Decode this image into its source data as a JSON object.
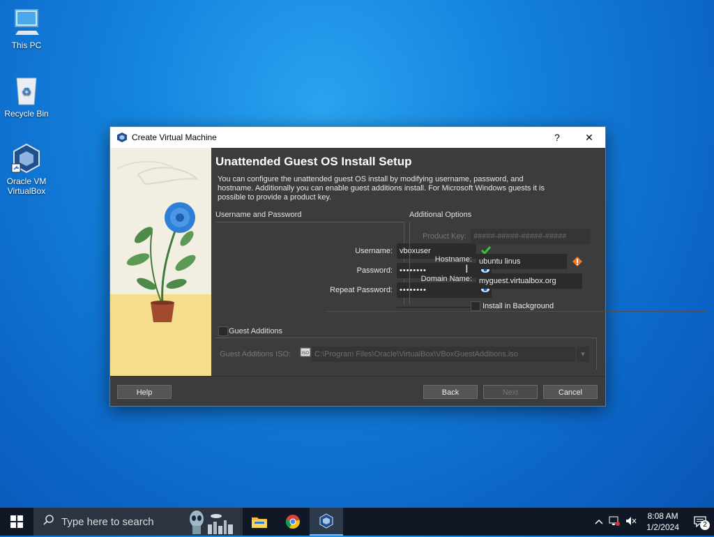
{
  "desktop": {
    "icons": [
      {
        "label": "This PC"
      },
      {
        "label": "Recycle Bin"
      },
      {
        "label": "Oracle VM VirtualBox"
      }
    ]
  },
  "dialog": {
    "title": "Create Virtual Machine",
    "help_glyph": "?",
    "close_glyph": "✕",
    "heading": "Unattended Guest OS Install Setup",
    "description": "You can configure the unattended guest OS install by modifying username, password, and hostname. Additionally you can enable guest additions install. For Microsoft Windows guests it is possible to provide a product key.",
    "user_group": {
      "title": "Username and Password",
      "username_label": "Username:",
      "username_value": "vboxuser",
      "password_label": "Password:",
      "password_value": "••••••••",
      "repeat_label": "Repeat Password:",
      "repeat_value": "••••••••"
    },
    "options_group": {
      "title": "Additional Options",
      "product_key_label": "Product Key:",
      "product_key_value": "#####-#####-#####-#####",
      "hostname_label": "Hostname:",
      "hostname_value": "ubuntu linus",
      "domain_label": "Domain Name:",
      "domain_value": "myguest.virtualbox.org",
      "background_label": "Install in Background"
    },
    "guest_additions": {
      "label": "Guest Additions",
      "iso_label": "Guest Additions ISO:",
      "iso_value": "C:\\Program Files\\Oracle\\VirtualBox\\VBoxGuestAdditions.iso"
    },
    "buttons": {
      "help": "Help",
      "back": "Back",
      "next": "Next",
      "cancel": "Cancel"
    }
  },
  "taskbar": {
    "search_placeholder": "Type here to search",
    "time": "8:08 AM",
    "date": "1/2/2024",
    "notification_count": "2"
  },
  "colors": {
    "valid": "#3fbf3f",
    "warning": "#f07a2a",
    "accent": "#2f7fd6"
  }
}
